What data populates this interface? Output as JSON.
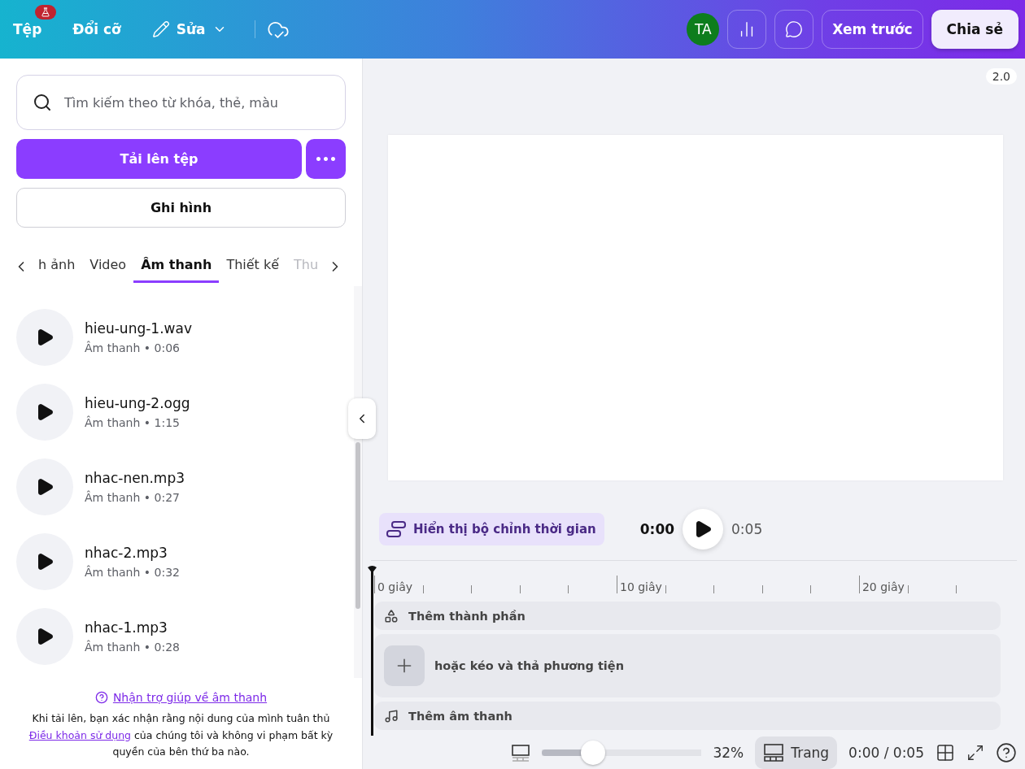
{
  "topbar": {
    "menu": [
      {
        "label": "Tệp",
        "kind": "badge"
      },
      {
        "label": "Đổi cỡ",
        "kind": "plain"
      },
      {
        "label": "Sửa",
        "kind": "edit"
      }
    ],
    "avatar": "TA",
    "preview": "Xem trước",
    "share": "Chia sẻ"
  },
  "sidebar": {
    "search": {
      "placeholder": "Tìm kiếm theo từ khóa, thẻ, màu"
    },
    "upload": "Tải lên tệp",
    "more": "•••",
    "record": "Ghi hình",
    "tabs": [
      {
        "label": "h ảnh",
        "selected": false,
        "faded": false
      },
      {
        "label": "Video",
        "selected": false,
        "faded": false
      },
      {
        "label": "Âm thanh",
        "selected": true,
        "faded": false
      },
      {
        "label": "Thiết kế",
        "selected": false,
        "faded": false
      },
      {
        "label": "Thu",
        "selected": false,
        "faded": true
      }
    ],
    "files": [
      {
        "name": "hieu-ung-1.wav",
        "meta": "Âm thanh • 0:06"
      },
      {
        "name": "hieu-ung-2.ogg",
        "meta": "Âm thanh • 1:15"
      },
      {
        "name": "nhac-nen.mp3",
        "meta": "Âm thanh • 0:27"
      },
      {
        "name": "nhac-2.mp3",
        "meta": "Âm thanh • 0:32"
      },
      {
        "name": "nhac-1.mp3",
        "meta": "Âm thanh • 0:28"
      }
    ],
    "help_link": "Nhận trợ giúp về âm thanh",
    "notice": {
      "before": "Khi tải lên, bạn xác nhận rằng nội dung của mình tuân thủ ",
      "link": "Điều khoản sử dụng",
      "after": " của chúng tôi và không vi phạm bất kỳ quyền của bên thứ ba nào."
    }
  },
  "editor": {
    "version": "2.0",
    "timing_button": "Hiển thị bộ chỉnh thời gian",
    "current_time": "0:00",
    "total_time": "0:05",
    "ruler": [
      "0 giây",
      "10 giây",
      "20 giây"
    ],
    "tracks": [
      {
        "kind": "elements",
        "label": "Thêm thành phần"
      },
      {
        "kind": "media",
        "label": "hoặc kéo và thả phương tiện"
      },
      {
        "kind": "audio",
        "label": "Thêm âm thanh"
      }
    ]
  },
  "bottom_bar": {
    "zoom": {
      "level": 0.32
    },
    "zoom_label": "32%",
    "page_button": "Trang",
    "time": "0:00 / 0:05"
  }
}
